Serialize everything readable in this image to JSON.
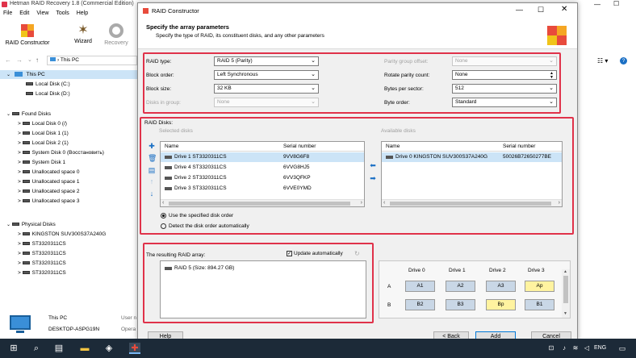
{
  "background_app": {
    "title": "Hetman RAID Recovery 1.8 (Commercial Edition)",
    "menu": [
      "File",
      "Edit",
      "View",
      "Tools",
      "Help"
    ],
    "toolbar": [
      {
        "label": "RAID Constructor",
        "icon": "puzzle-icon"
      },
      {
        "label": "Wizard",
        "icon": "wand-icon"
      },
      {
        "label": "Recovery",
        "icon": "lifebuoy-icon"
      }
    ],
    "nav_path": "This PC",
    "tree": {
      "this_pc": "This PC",
      "local_disks": [
        "Local Disk (C:)",
        "Local Disk (D:)"
      ],
      "found_disks_header": "Found Disks",
      "found_disks": [
        "Local Disk 0 (/)",
        "Local Disk 1 (1)",
        "Local Disk 2 (1)",
        "System Disk 0 (Восстановить)",
        "System Disk 1",
        "Unallocated space 0",
        "Unallocated space 1",
        "Unallocated space 2",
        "Unallocated space 3"
      ],
      "physical_disks_header": "Physical Disks",
      "physical_disks": [
        "KINGSTON SUV300S37A240G",
        "ST3320311CS",
        "ST3320311CS",
        "ST3320311CS",
        "ST3320311CS"
      ]
    },
    "status": {
      "name": "This PC",
      "computer": "DESKTOP-ASPG19N",
      "user_label": "User n",
      "os_label": "Opera"
    }
  },
  "dialog": {
    "title": "RAID Constructor",
    "header_title": "Specify the array parameters",
    "header_subtitle": "Specify the type of RAID, its constituent disks, and any other parameters",
    "params": {
      "raid_type_label": "RAID type:",
      "raid_type_value": "RAID 5 (Parity)",
      "block_order_label": "Block order:",
      "block_order_value": "Left Synchronous",
      "block_size_label": "Block size:",
      "block_size_value": "32 KB",
      "disks_in_group_label": "Disks in group:",
      "disks_in_group_value": "None",
      "parity_offset_label": "Parity group offset:",
      "parity_offset_value": "None",
      "rotate_parity_label": "Rotate parity count:",
      "rotate_parity_value": "None",
      "bytes_per_sector_label": "Bytes per sector:",
      "bytes_per_sector_value": "512",
      "byte_order_label": "Byte order:",
      "byte_order_value": "Standard"
    },
    "raid_disks": {
      "label": "RAID Disks:",
      "selected_label": "Selected disks",
      "available_label": "Available disks",
      "col_name": "Name",
      "col_serial": "Serial number",
      "selected": [
        {
          "name": "Drive 1 ST3320311CS",
          "serial": "9VV8G6F8"
        },
        {
          "name": "Drive 4 ST3320311CS",
          "serial": "6VVG8HJ5"
        },
        {
          "name": "Drive 2 ST3320311CS",
          "serial": "6VV3QFKP"
        },
        {
          "name": "Drive 3 ST3320311CS",
          "serial": "6VVE0YMD"
        }
      ],
      "available": [
        {
          "name": "Drive 0 KINGSTON SUV300S37A240G",
          "serial": "50026B72650277BE"
        }
      ],
      "radio_specified": "Use the specified disk order",
      "radio_detect": "Detect the disk order automatically"
    },
    "result": {
      "label": "The resulting RAID array:",
      "update_auto": "Update automatically",
      "item": "RAID 5 (Size: 894.27 GB)"
    },
    "grid": {
      "columns": [
        "Drive 0",
        "Drive 1",
        "Drive 2",
        "Drive 3"
      ],
      "rows": [
        {
          "label": "A",
          "cells": [
            "A1",
            "A2",
            "A3",
            "Ap"
          ]
        },
        {
          "label": "B",
          "cells": [
            "B2",
            "B3",
            "Bp",
            "B1"
          ]
        }
      ],
      "parity_color": "#fff3a0",
      "data_color": "#c9d7e6"
    },
    "buttons": {
      "help": "Help",
      "back": "< Back",
      "add": "Add",
      "cancel": "Cancel"
    }
  },
  "taskbar": {
    "lang": "ENG"
  }
}
